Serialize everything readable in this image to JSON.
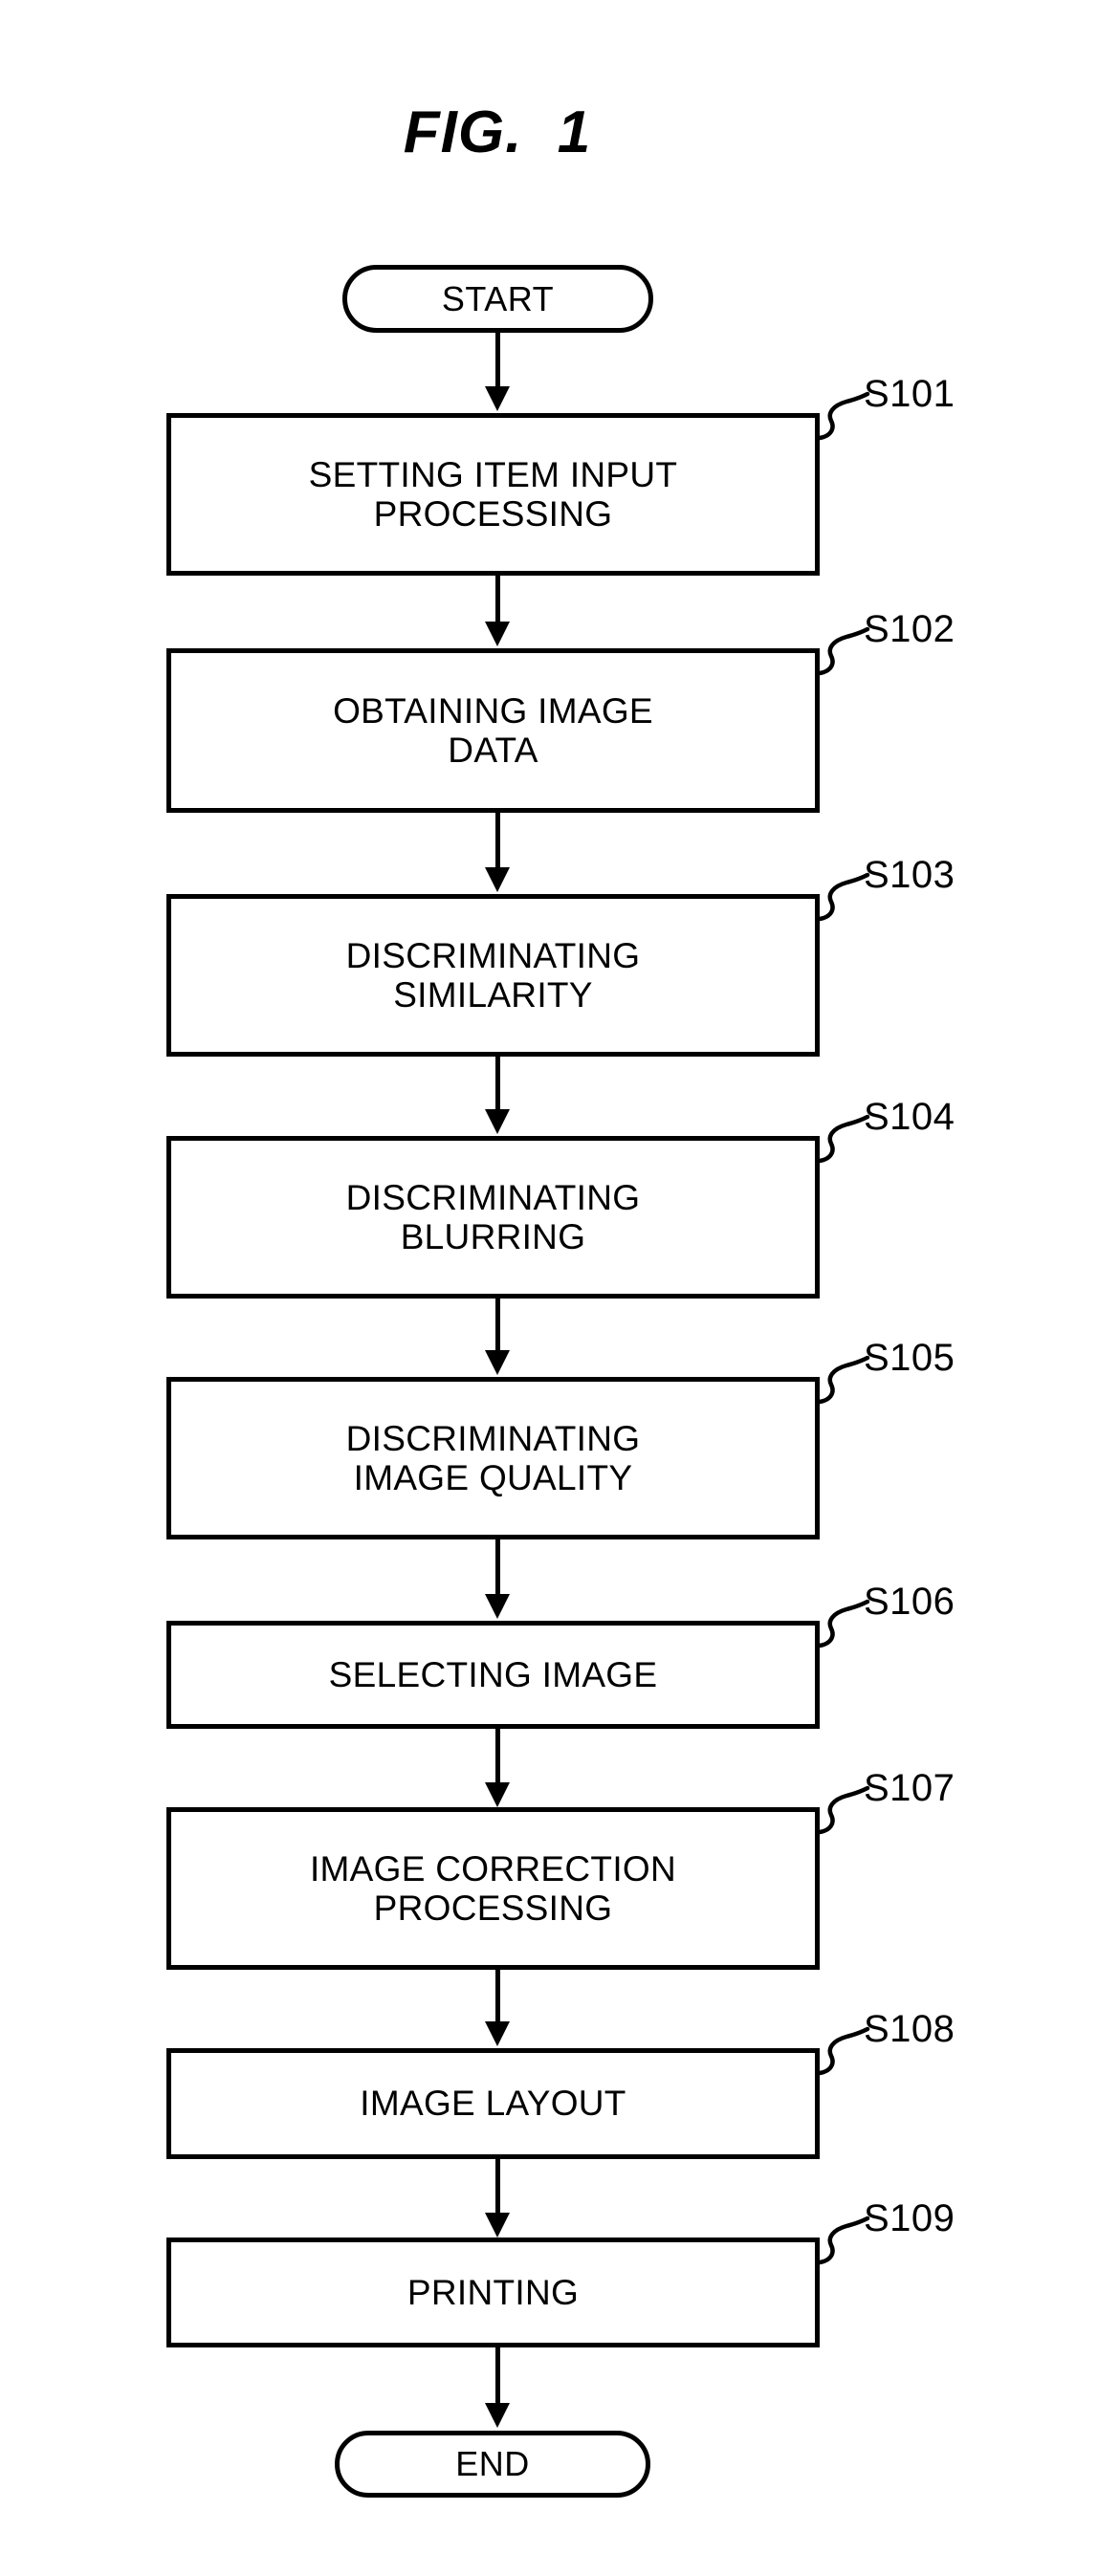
{
  "figure": {
    "title": "FIG.  1"
  },
  "flowchart": {
    "start": {
      "label": "START"
    },
    "end": {
      "label": "END"
    },
    "steps": [
      {
        "ref": "S101",
        "label": "SETTING ITEM INPUT\nPROCESSING"
      },
      {
        "ref": "S102",
        "label": "OBTAINING IMAGE\nDATA"
      },
      {
        "ref": "S103",
        "label": "DISCRIMINATING\nSIMILARITY"
      },
      {
        "ref": "S104",
        "label": "DISCRIMINATING\nBLURRING"
      },
      {
        "ref": "S105",
        "label": "DISCRIMINATING\nIMAGE QUALITY"
      },
      {
        "ref": "S106",
        "label": "SELECTING IMAGE"
      },
      {
        "ref": "S107",
        "label": "IMAGE CORRECTION\nPROCESSING"
      },
      {
        "ref": "S108",
        "label": "IMAGE LAYOUT"
      },
      {
        "ref": "S109",
        "label": "PRINTING"
      }
    ]
  },
  "style": {
    "ink": "#000000",
    "paper": "#ffffff"
  }
}
